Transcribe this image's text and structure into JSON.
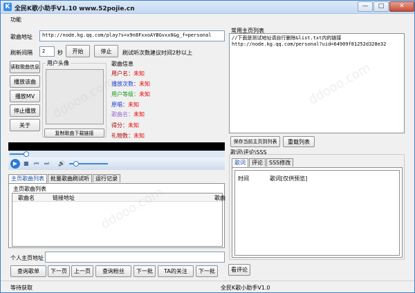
{
  "window": {
    "title": "全民K歌小助手V1.10 www.52pojie.cn",
    "minimize": "—",
    "maximize": "□",
    "close": "✕"
  },
  "menu": {
    "items": [
      "功能"
    ]
  },
  "song_address": {
    "label": "歌曲地址",
    "value": "http://node.kg.qq.com/play?s=x9n8FxxoAYBGvxx0&g_f=personal"
  },
  "refresh": {
    "label": "刷新间隔",
    "value": "2",
    "unit": "秒",
    "start_button": "开始",
    "stop_button": "停止",
    "hint": "刷试听次数建议时间2秒以上"
  },
  "left_buttons": [
    "读取歌曲信息",
    "播放该曲",
    "播放MV",
    "停止播放",
    "关于"
  ],
  "user_avatar": {
    "label": "用户头像",
    "copy_button": "复制歌曲下载链接"
  },
  "song_info": {
    "label": "歌曲信息",
    "rows": [
      {
        "key": "用户名：",
        "value": "未知",
        "color": "#b00000"
      },
      {
        "key": "播放次数：",
        "value": "未知",
        "color": "#1a3fd0"
      },
      {
        "key": "用户等级：",
        "value": "未知",
        "color": "#1a9a1a"
      },
      {
        "key": "原唱：",
        "value": "未知",
        "color": "#1a3fd0"
      },
      {
        "key": "歌曲名：",
        "value": "未知",
        "color": "#9a6ad0"
      },
      {
        "key": "得分：",
        "value": "未知",
        "color": "#b00000"
      },
      {
        "key": "礼物数：",
        "value": "未知",
        "color": "#b00000"
      }
    ]
  },
  "player": {
    "progress": 0.07,
    "volume": 0.25
  },
  "bottom_tabs": [
    "主页歌曲列表",
    "批量歌曲刷试听",
    "运行记录"
  ],
  "home_list": {
    "label": "主页歌曲列表",
    "columns": [
      "歌曲名",
      "链接地址",
      "歌曲"
    ]
  },
  "personal_home": {
    "label": "个人主页地址",
    "value": ""
  },
  "bottom_buttons": [
    "查询歌单",
    "下一页",
    "上一页",
    "查询粉丝",
    "下一批",
    "TA的关注",
    "下一批",
    "看评论"
  ],
  "common_pages": {
    "label": "常用主页列表",
    "lines": [
      "//下面是测试地址请自行删除&list.txt内的链接",
      "http://node.kg.qq.com/personal?uid=64909f81252d328e32"
    ],
    "save_button": "保存当前主页到列表",
    "reload_button": "重载列表"
  },
  "lyrics_group": {
    "label": "歌词\\评论\\SSS",
    "tabs": [
      "歌词",
      "评论",
      "SSS修改"
    ],
    "columns": [
      "时间",
      "歌词[仅供预览]"
    ]
  },
  "status": {
    "left": "等待获取",
    "right": "全民K歌小助手V1.0"
  },
  "watermark": "ddooo.com"
}
